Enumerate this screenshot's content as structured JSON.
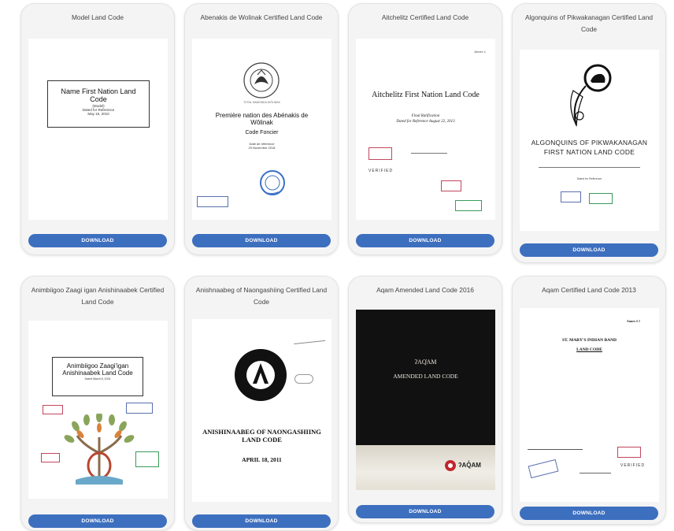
{
  "download_label": "DOWNLOAD",
  "cards": [
    {
      "title": "Model Land Code",
      "doc": {
        "title": "Name First Nation Land Code",
        "line1": "(Model)",
        "line2": "Dated for Reference",
        "line3": "May 15, 2010"
      }
    },
    {
      "title": "Abenakis de Wolinak Certified Land Code",
      "doc": {
        "seal": "TOTAL NAWONDA WÔLINAK",
        "title": "Première nation des Abénakis de Wôlinak",
        "subtitle": "Code Foncier",
        "line1": "Date de référence",
        "line2": "29 Novembre 2018"
      }
    },
    {
      "title": "Aitchelitz Certified Land Code",
      "doc": {
        "annex": "Annex 1",
        "title": "Aitchelitz First Nation Land Code",
        "line1": "Final Ratification",
        "line2": "Dated for Reference August 22, 2013",
        "verified": "VERIFIED"
      }
    },
    {
      "title": "Algonquins of Pikwakanagan Certified Land Code",
      "doc": {
        "title": "ALGONQUINS OF PIKWAKANAGAN FIRST NATION LAND CODE",
        "line1": "Dated for Reference"
      }
    },
    {
      "title": "Animbiigoo Zaagi igan Anishinaabek Certified Land Code",
      "doc": {
        "title": "Animbiigoo Zaagi'igan Anishinaabek Land Code",
        "line1": "Dated March 8, 2024"
      }
    },
    {
      "title": "Anishnaabeg of Naongashiing Certified Land Code",
      "doc": {
        "title": "ANISHINAABEG OF NAONGASHIING LAND CODE",
        "date": "APRIL 18, 2011"
      }
    },
    {
      "title": "Aqam Amended Land Code 2016",
      "doc": {
        "title": "ʔAQ̓AM",
        "subtitle": "AMENDED LAND CODE",
        "brand": "ʔAQ̓AM"
      }
    },
    {
      "title": "Aqam Certified Land Code 2013",
      "doc": {
        "annex": "Annex # 1",
        "title": "ST. MARY'S INDIAN BAND",
        "subtitle": "LAND CODE",
        "verified": "VERIFIED"
      }
    }
  ]
}
